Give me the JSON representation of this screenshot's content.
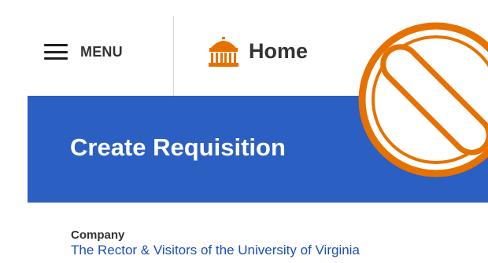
{
  "header": {
    "menu_label": "MENU",
    "home_label": "Home"
  },
  "banner": {
    "title": "Create Requisition"
  },
  "form": {
    "company_label": "Company",
    "company_value": "The Rector & Visitors of the University of Virginia"
  },
  "colors": {
    "banner_blue": "#2b5fc2",
    "link_blue": "#1a4fb4",
    "home_icon_orange": "#e57200",
    "no_sign_orange": "#e57200"
  },
  "icons": {
    "menu": "hamburger-icon",
    "home": "rotunda-icon",
    "overlay": "prohibited-icon"
  }
}
